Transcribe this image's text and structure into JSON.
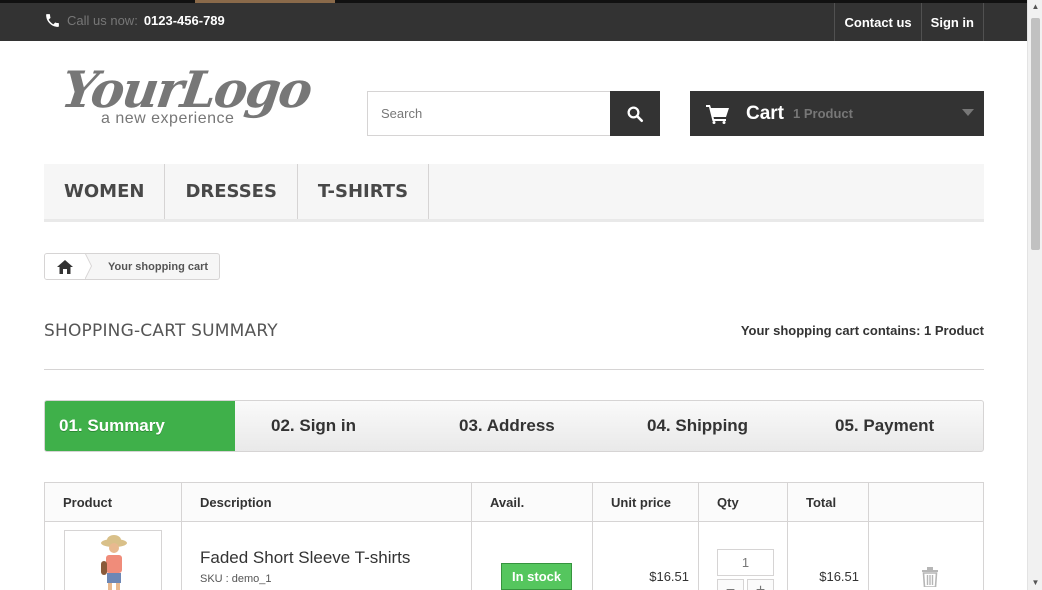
{
  "topbar": {
    "call_label": "Call us now:",
    "phone": "0123-456-789",
    "nav": [
      "Contact us",
      "Sign in"
    ]
  },
  "logo": {
    "title": "YourLogo",
    "tagline": "a new experience"
  },
  "search": {
    "placeholder": "Search"
  },
  "cart": {
    "label": "Cart",
    "count": "1 Product"
  },
  "menu": [
    "WOMEN",
    "DRESSES",
    "T-SHIRTS"
  ],
  "breadcrumb": {
    "current": "Your shopping cart"
  },
  "summary": {
    "title": "SHOPPING-CART SUMMARY",
    "count_text": "Your shopping cart contains: 1 Product"
  },
  "steps": [
    "01. Summary",
    "02. Sign in",
    "03. Address",
    "04. Shipping",
    "05. Payment"
  ],
  "table": {
    "headers": [
      "Product",
      "Description",
      "Avail.",
      "Unit price",
      "Qty",
      "Total",
      ""
    ],
    "rows": [
      {
        "name": "Faded Short Sleeve T-shirts",
        "sku": "SKU : demo_1",
        "availability": "In stock",
        "unit_price": "$16.51",
        "qty": "1",
        "total": "$16.51"
      }
    ]
  },
  "colors": {
    "accent_green": "#3fb04a",
    "dark": "#333333"
  }
}
